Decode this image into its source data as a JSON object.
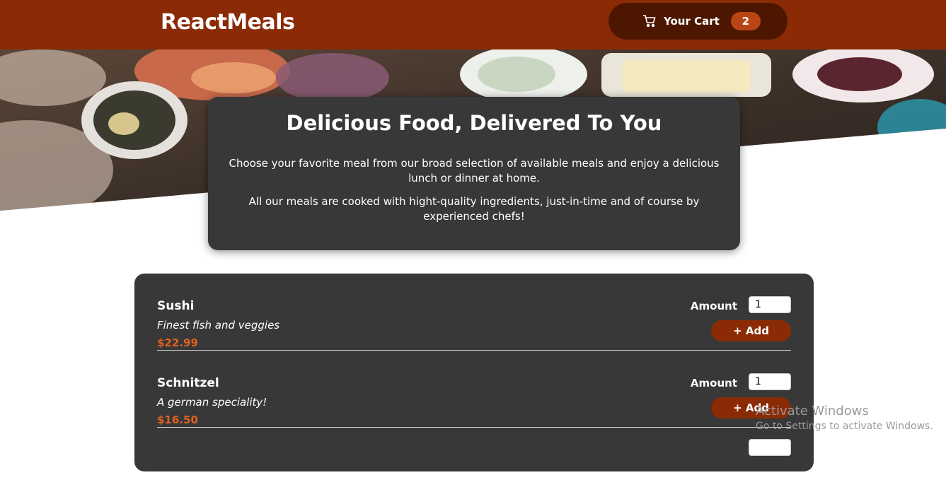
{
  "header": {
    "brand": "ReactMeals",
    "cart_label": "Your Cart",
    "cart_count": "2"
  },
  "summary": {
    "title": "Delicious Food, Delivered To You",
    "paragraph1": "Choose your favorite meal from our broad selection of available meals and enjoy a delicious lunch or dinner at home.",
    "paragraph2": "All our meals are cooked with hight-quality ingredients, just-in-time and of course by experienced chefs!"
  },
  "meals": [
    {
      "name": "Sushi",
      "description": "Finest fish and veggies",
      "price": "$22.99",
      "amount_label": "Amount",
      "amount": "1",
      "add_label": "+ Add"
    },
    {
      "name": "Schnitzel",
      "description": "A german speciality!",
      "price": "$16.50",
      "amount_label": "Amount",
      "amount": "1",
      "add_label": "+ Add"
    }
  ],
  "watermark": {
    "title": "Activate Windows",
    "subtitle": "Go to Settings to activate Windows."
  },
  "colors": {
    "header": "#8a2b06",
    "cart_button": "#4d1601",
    "badge": "#b94517",
    "card": "#383838",
    "price": "#e0621f"
  },
  "icons": {
    "cart": "cart-icon"
  }
}
